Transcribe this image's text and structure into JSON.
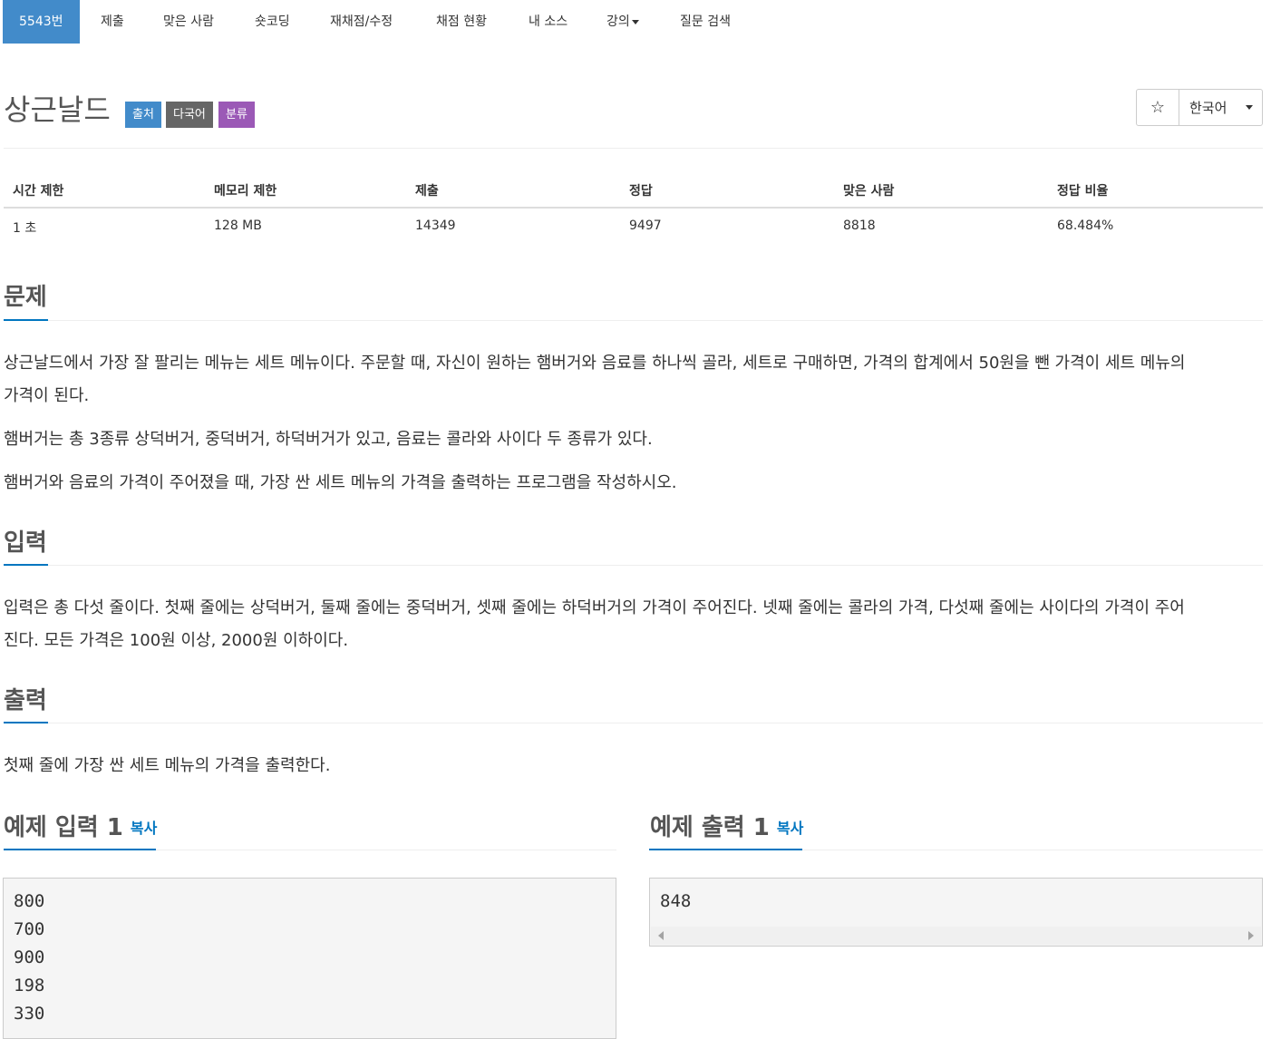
{
  "nav": {
    "items": [
      {
        "label": "5543번",
        "active": true
      },
      {
        "label": "제출"
      },
      {
        "label": "맞은 사람"
      },
      {
        "label": "숏코딩"
      },
      {
        "label": "재채점/수정"
      },
      {
        "label": "채점 현황"
      },
      {
        "label": "내 소스"
      },
      {
        "label": "강의"
      },
      {
        "label": "질문 검색"
      }
    ]
  },
  "problem": {
    "title": "상근날드",
    "tags": [
      "출처",
      "다국어",
      "분류"
    ],
    "star_icon": "☆",
    "language": "한국어"
  },
  "stats": {
    "headers": [
      "시간 제한",
      "메모리 제한",
      "제출",
      "정답",
      "맞은 사람",
      "정답 비율"
    ],
    "values": [
      "1 초",
      "128 MB",
      "14349",
      "9497",
      "8818",
      "68.484%"
    ]
  },
  "sections": {
    "problem_head": "문제",
    "problem_text": [
      "상근날드에서 가장 잘 팔리는 메뉴는 세트 메뉴이다. 주문할 때, 자신이 원하는 햄버거와 음료를 하나씩 골라, 세트로 구매하면, 가격의 합계에서 50원을 뺀 가격이 세트 메뉴의",
      "가격이 된다.",
      "햄버거는 총 3종류 상덕버거, 중덕버거, 하덕버거가 있고, 음료는 콜라와 사이다 두 종류가 있다.",
      "햄버거와 음료의 가격이 주어졌을 때, 가장 싼 세트 메뉴의 가격을 출력하는 프로그램을 작성하시오."
    ],
    "input_head": "입력",
    "input_text": [
      "입력은 총 다섯 줄이다. 첫째 줄에는 상덕버거, 둘째 줄에는 중덕버거, 셋째 줄에는 하덕버거의 가격이 주어진다. 넷째 줄에는 콜라의 가격, 다섯째 줄에는 사이다의 가격이 주어",
      "진다. 모든 가격은 100원 이상, 2000원 이하이다."
    ],
    "output_head": "출력",
    "output_text": "첫째 줄에 가장 싼 세트 메뉴의 가격을 출력한다."
  },
  "samples": {
    "input_head": "예제 입력 1",
    "output_head": "예제 출력 1",
    "copy_label": "복사",
    "input_lines": [
      "800",
      "700",
      "900",
      "198",
      "330"
    ],
    "output_lines": [
      "848"
    ]
  }
}
